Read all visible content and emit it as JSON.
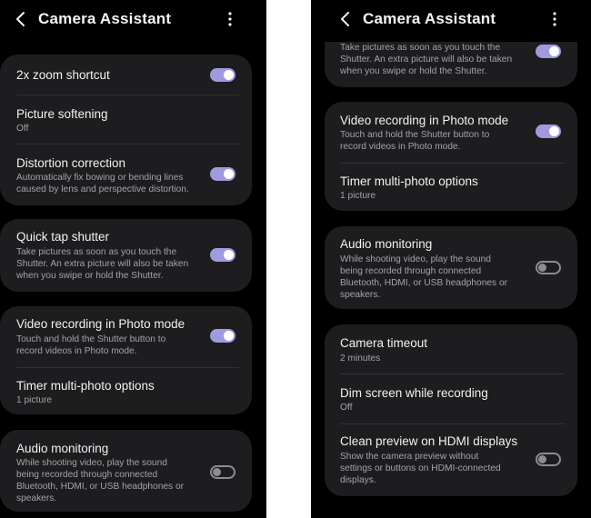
{
  "app": {
    "title": "Camera Assistant"
  },
  "left": {
    "zoom": {
      "title": "2x zoom shortcut",
      "on": true
    },
    "softening": {
      "title": "Picture softening",
      "value": "Off"
    },
    "distortion": {
      "title": "Distortion correction",
      "desc1": "Automatically fix bowing or bending lines",
      "desc2": "caused by lens and perspective distortion.",
      "on": true
    },
    "quicktap": {
      "title": "Quick tap shutter",
      "desc1": "Take pictures as soon as you touch the",
      "desc2": "Shutter. An extra picture will also be taken",
      "desc3": "when you swipe or hold the Shutter.",
      "on": true
    },
    "video": {
      "title": "Video recording in Photo mode",
      "desc1": "Touch and hold the Shutter button to",
      "desc2": "record videos in Photo mode.",
      "on": true
    },
    "timer": {
      "title": "Timer multi-photo options",
      "value": "1 picture"
    },
    "audio": {
      "title": "Audio monitoring",
      "desc1": "While shooting video, play the sound",
      "desc2": "being recorded through connected",
      "desc3": "Bluetooth, HDMI, or USB headphones or",
      "desc4": "speakers.",
      "on": false
    }
  },
  "right": {
    "quicktap": {
      "desc1": "Take pictures as soon as you touch the",
      "desc2": "Shutter. An extra picture will also be taken",
      "desc3": "when you swipe or hold the Shutter.",
      "on": true
    },
    "video": {
      "title": "Video recording in Photo mode",
      "desc1": "Touch and hold the Shutter button to",
      "desc2": "record videos in Photo mode.",
      "on": true
    },
    "timer": {
      "title": "Timer multi-photo options",
      "value": "1 picture"
    },
    "audio": {
      "title": "Audio monitoring",
      "desc1": "While shooting video, play the sound",
      "desc2": "being recorded through connected",
      "desc3": "Bluetooth, HDMI, or USB headphones or",
      "desc4": "speakers.",
      "on": false
    },
    "timeout": {
      "title": "Camera timeout",
      "value": "2 minutes"
    },
    "dim": {
      "title": "Dim screen while recording",
      "value": "Off"
    },
    "hdmi": {
      "title": "Clean preview on HDMI displays",
      "desc1": "Show the camera preview without",
      "desc2": "settings or buttons on HDMI-connected",
      "desc3": "displays.",
      "on": false
    }
  },
  "colors": {
    "toggle_on": "#a09adf",
    "card": "#1d1d1f",
    "background": "#000000"
  },
  "icons": {
    "back": "chevron-left-icon",
    "more": "more-vertical-icon"
  }
}
